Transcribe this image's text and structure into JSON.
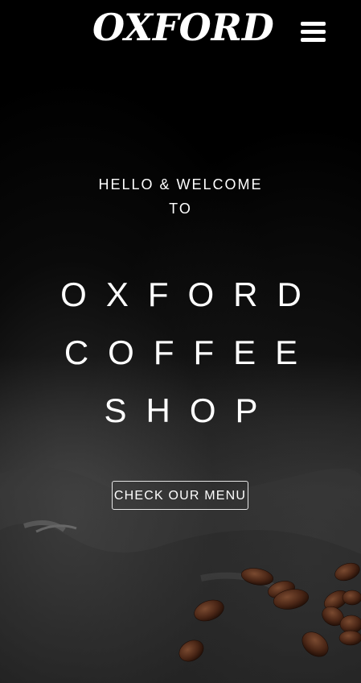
{
  "header": {
    "logo_text": "OXFORD",
    "menu_icon": "hamburger-menu-icon"
  },
  "hero": {
    "welcome_line1": "HELLO & WELCOME",
    "welcome_line2": "TO",
    "headline_line1": "OXFORD",
    "headline_line2": "COFFEE",
    "headline_line3": "SHOP",
    "cta_label": "CHECK OUR MENU"
  },
  "colors": {
    "background": "#000000",
    "text": "#ffffff",
    "bean": "#4a2616"
  }
}
